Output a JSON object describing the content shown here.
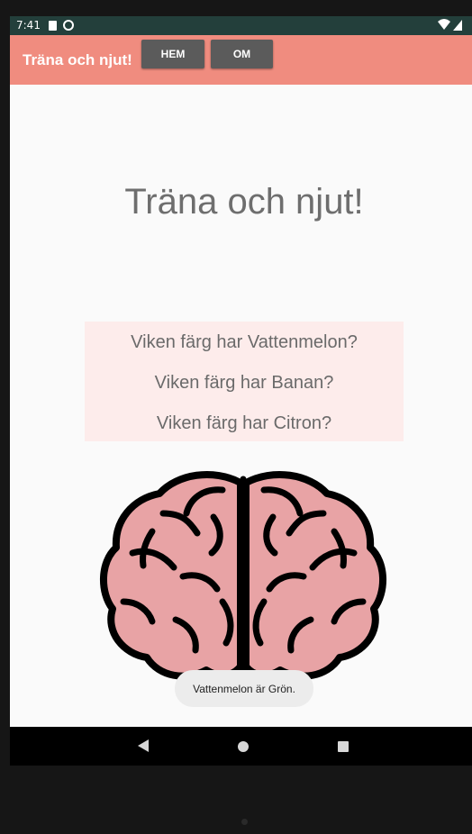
{
  "status_bar": {
    "time": "7:41"
  },
  "app_bar": {
    "title": "Träna och njut!",
    "buttons": {
      "home": "HEM",
      "about": "OM"
    }
  },
  "main": {
    "heading": "Träna och njut!",
    "questions": [
      "Viken färg har Vattenmelon?",
      "Viken färg har Banan?",
      "Viken färg har Citron?"
    ],
    "brain_image": {
      "icon": "brain-illustration",
      "color": "#e8a3a5"
    }
  },
  "toast": {
    "message": "Vattenmelon är Grön."
  },
  "colors": {
    "status_bar": "#233f3b",
    "app_bar": "#f08c7f",
    "button": "#5b5b5b",
    "question_box": "#fdeceb",
    "content_bg": "#fafafa"
  }
}
